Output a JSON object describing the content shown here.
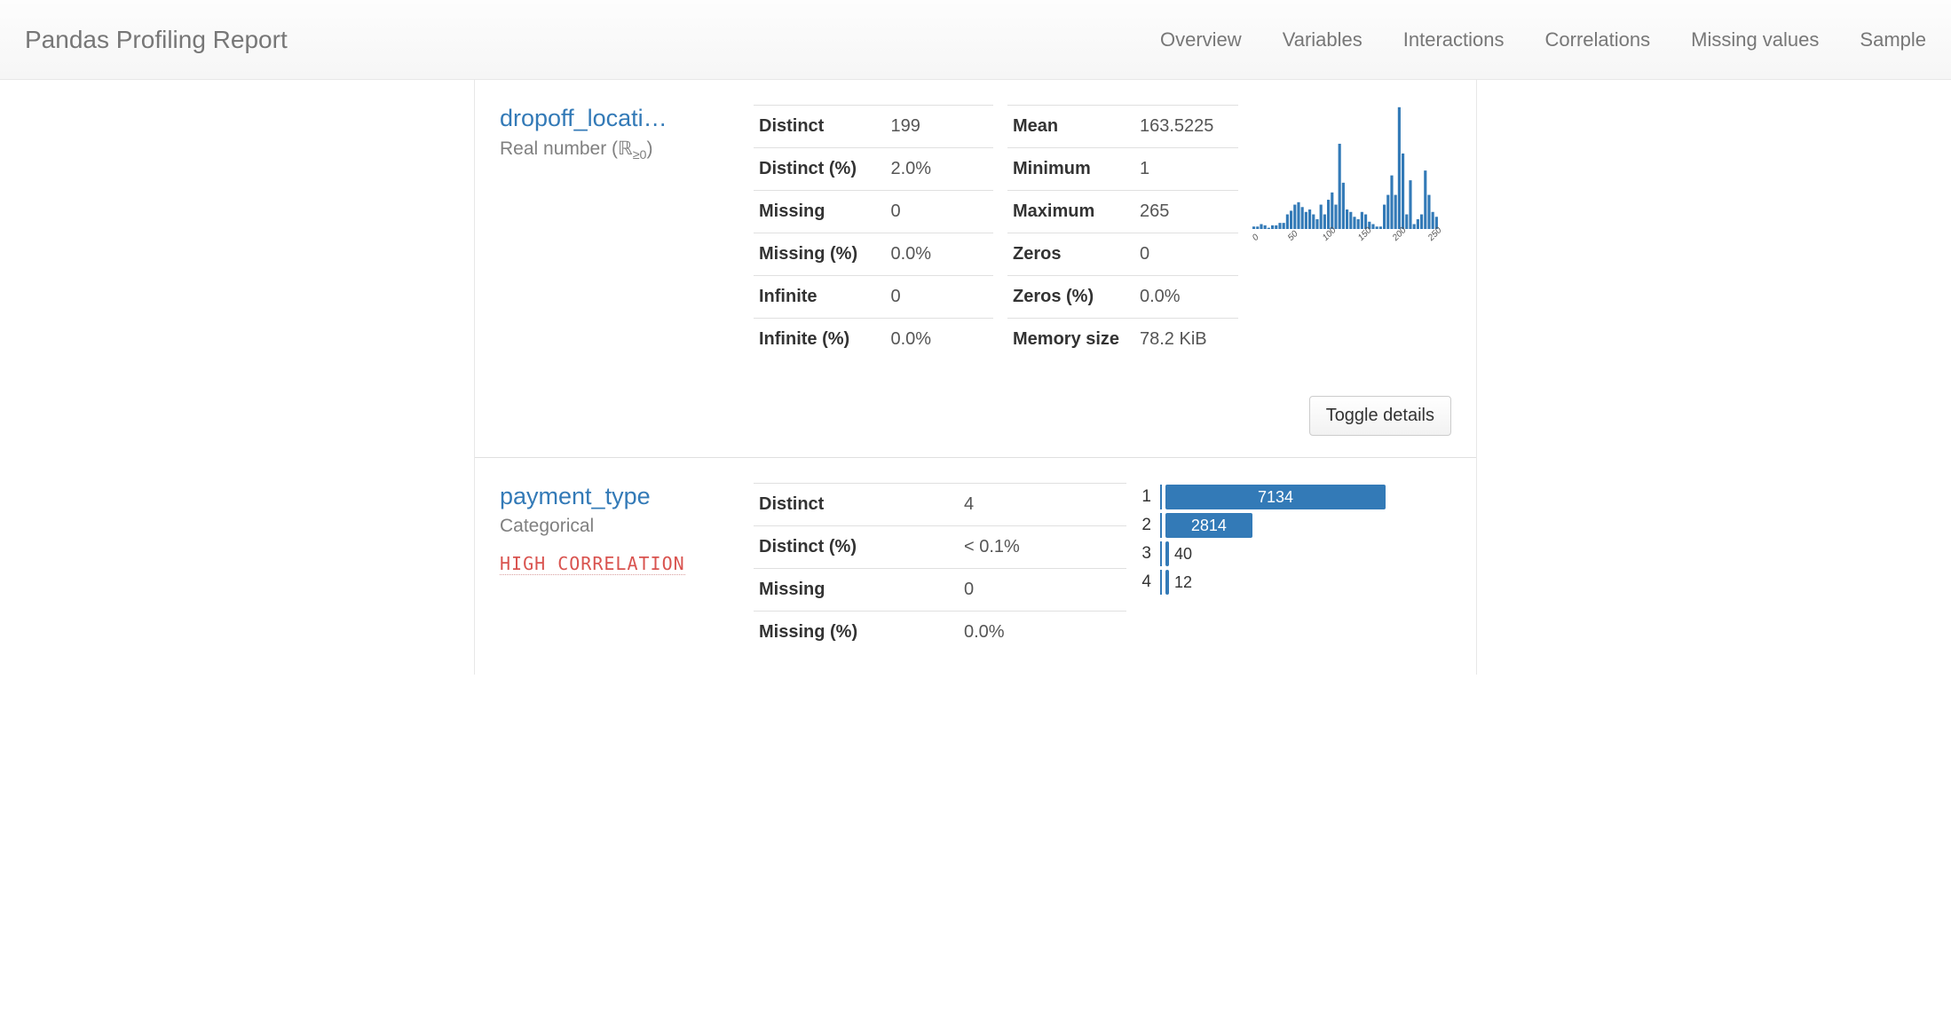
{
  "navbar": {
    "title": "Pandas Profiling Report",
    "items": [
      "Overview",
      "Variables",
      "Interactions",
      "Correlations",
      "Missing values",
      "Sample"
    ]
  },
  "var1": {
    "name": "dropoff_locati…",
    "type_html": "Real number (ℝ<sub>≥0</sub>)",
    "stats_left": [
      {
        "k": "Distinct",
        "v": "199"
      },
      {
        "k": "Distinct (%)",
        "v": "2.0%"
      },
      {
        "k": "Missing",
        "v": "0"
      },
      {
        "k": "Missing (%)",
        "v": "0.0%"
      },
      {
        "k": "Infinite",
        "v": "0"
      },
      {
        "k": "Infinite (%)",
        "v": "0.0%"
      }
    ],
    "stats_right": [
      {
        "k": "Mean",
        "v": "163.5225"
      },
      {
        "k": "Minimum",
        "v": "1"
      },
      {
        "k": "Maximum",
        "v": "265"
      },
      {
        "k": "Zeros",
        "v": "0"
      },
      {
        "k": "Zeros (%)",
        "v": "0.0%"
      },
      {
        "k": "Memory size",
        "v": "78.2 KiB"
      }
    ],
    "toggle": "Toggle details"
  },
  "var2": {
    "name": "payment_type",
    "type": "Categorical",
    "warn": "HIGH CORRELATION",
    "stats": [
      {
        "k": "Distinct",
        "v": "4"
      },
      {
        "k": "Distinct (%)",
        "v": "< 0.1%"
      },
      {
        "k": "Missing",
        "v": "0"
      },
      {
        "k": "Missing (%)",
        "v": "0.0%"
      }
    ],
    "freq": [
      {
        "label": "1",
        "value": 7134
      },
      {
        "label": "2",
        "value": 2814
      },
      {
        "label": "3",
        "value": 40
      },
      {
        "label": "4",
        "value": 12
      }
    ]
  },
  "chart_data": {
    "type": "bar",
    "title": "",
    "xlabel": "",
    "ylabel": "",
    "x_ticks": [
      0,
      50,
      100,
      150,
      200,
      250
    ],
    "xlim": [
      0,
      265
    ],
    "categories_note": "one bin per x-tick interval approximation from sparkline",
    "values": [
      2,
      2,
      4,
      3,
      1,
      3,
      3,
      5,
      5,
      12,
      15,
      20,
      22,
      18,
      14,
      16,
      12,
      8,
      20,
      12,
      24,
      30,
      20,
      70,
      38,
      16,
      14,
      10,
      8,
      14,
      12,
      6,
      4,
      2,
      2,
      20,
      28,
      44,
      28,
      100,
      62,
      12,
      40,
      4,
      8,
      12,
      48,
      28,
      14,
      10
    ]
  }
}
